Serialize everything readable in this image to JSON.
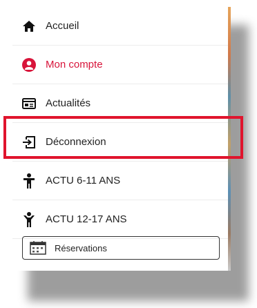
{
  "menu": {
    "items": [
      {
        "label": "Accueil",
        "icon": "home-icon"
      },
      {
        "label": "Mon compte",
        "icon": "account-circle-icon",
        "color": "#d8143a"
      },
      {
        "label": "Actualités",
        "icon": "newspaper-icon"
      },
      {
        "label": "Déconnexion",
        "icon": "logout-icon"
      },
      {
        "label": "ACTU 6-11 ANS",
        "icon": "child-icon"
      },
      {
        "label": "ACTU 12-17 ANS",
        "icon": "teen-icon"
      }
    ],
    "reservations_label": "Réservations"
  },
  "highlight_color": "#e0142d"
}
